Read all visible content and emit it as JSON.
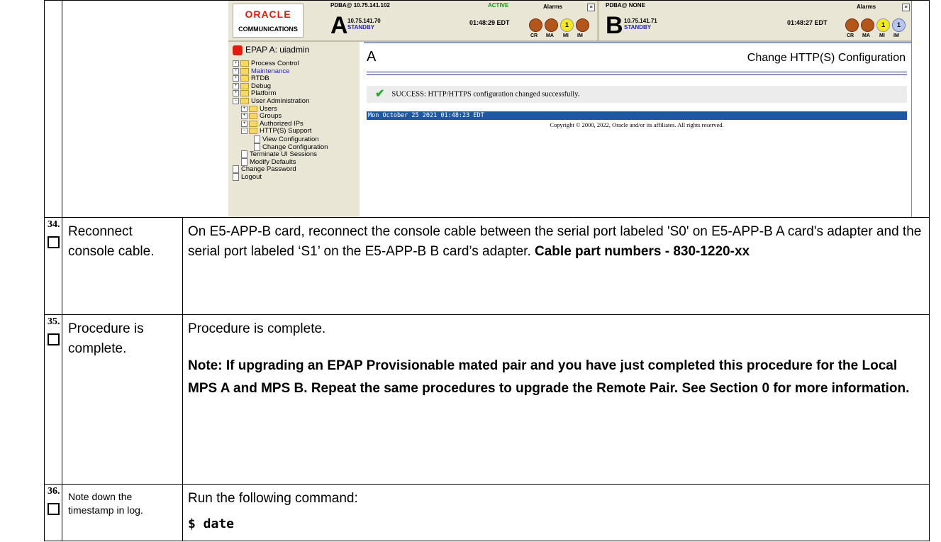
{
  "screenshot": {
    "logo": {
      "brand": "ORACLE",
      "sub": "COMMUNICATIONS"
    },
    "server_a": {
      "pdba": "PDBA@ 10.75.141.102",
      "status": "ACTIVE",
      "alarms": "Alarms",
      "letter": "A",
      "ip": "10.75.141.70",
      "role": "STANDBY",
      "time": "01:48:29 EDT",
      "lamps": [
        "",
        "",
        "1",
        ""
      ],
      "lamp_labels": [
        "CR",
        "MA",
        "MI",
        "IM"
      ]
    },
    "server_b": {
      "pdba": "PDBA@ NONE",
      "alarms": "Alarms",
      "letter": "B",
      "ip": "10.75.141.71",
      "role": "STANDBY",
      "time": "01:48:27 EDT",
      "lamps": [
        "",
        "",
        "1",
        "1"
      ],
      "lamp_labels": [
        "CR",
        "MA",
        "MI",
        "IM"
      ]
    },
    "sidebar": {
      "header": "EPAP A: uiadmin",
      "items": [
        {
          "label": "Process Control",
          "kind": "folder",
          "pm": "+"
        },
        {
          "label": "Maintenance",
          "kind": "folder",
          "pm": "+"
        },
        {
          "label": "RTDB",
          "kind": "folder",
          "pm": "+"
        },
        {
          "label": "Debug",
          "kind": "folder",
          "pm": "+"
        },
        {
          "label": "Platform",
          "kind": "folder",
          "pm": "+"
        },
        {
          "label": "User Administration",
          "kind": "folder",
          "pm": "−"
        },
        {
          "label": "Users",
          "kind": "folder",
          "pm": "+"
        },
        {
          "label": "Groups",
          "kind": "folder",
          "pm": "+"
        },
        {
          "label": "Authorized IPs",
          "kind": "folder",
          "pm": "+"
        },
        {
          "label": "HTTP(S) Support",
          "kind": "folder",
          "pm": "−"
        },
        {
          "label": "View Configuration",
          "kind": "page"
        },
        {
          "label": "Change Configuration",
          "kind": "page"
        },
        {
          "label": "Terminate UI Sessions",
          "kind": "page"
        },
        {
          "label": "Modify Defaults",
          "kind": "page"
        },
        {
          "label": "Change Password",
          "kind": "page"
        },
        {
          "label": "Logout",
          "kind": "page"
        }
      ]
    },
    "main": {
      "letter": "A",
      "title": "Change HTTP(S) Configuration",
      "success": "SUCCESS: HTTP/HTTPS configuration changed successfully.",
      "date": "Mon October 25 2021 01:48:23 EDT",
      "copyright": "Copyright © 2000, 2022, Oracle and/or its affiliates. All rights reserved."
    }
  },
  "steps": [
    {
      "number": "34.",
      "description": "Reconnect console cable.",
      "body": "On E5-APP-B card, reconnect the console cable between the serial port labeled 'S0' on E5-APP-B A card's adapter and the serial port labeled ‘S1’ on the E5-APP-B B card’s adapter.",
      "body_bold": "Cable part numbers - 830-1220-xx"
    },
    {
      "number": "35.",
      "description": "Procedure is complete.",
      "body": "Procedure is complete.",
      "note": "Note: If upgrading an EPAP Provisionable mated pair and you have just completed this procedure for the Local MPS A and MPS B. Repeat the same procedures to upgrade the Remote Pair.  See Section 0 for more information."
    },
    {
      "number": "36.",
      "description": "Note down the timestamp in log.",
      "body": "Run the following command:",
      "command": "$ date"
    }
  ]
}
